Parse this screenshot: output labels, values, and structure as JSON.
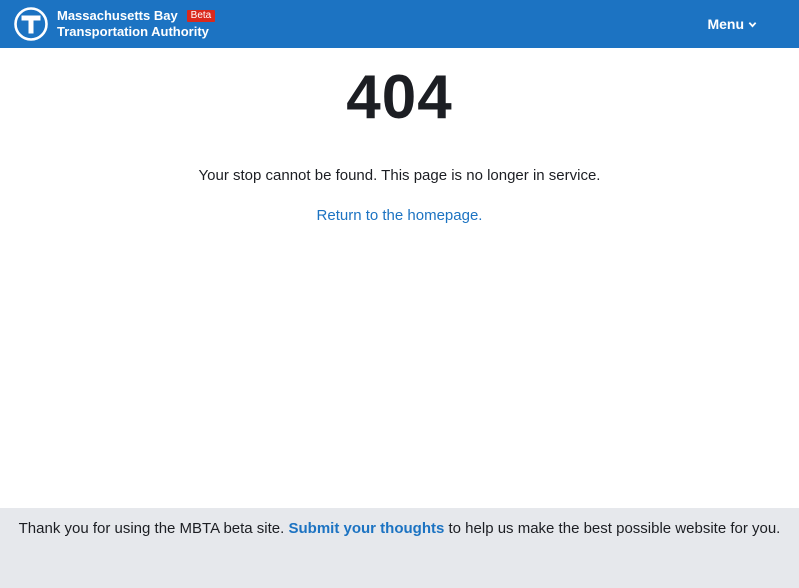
{
  "header": {
    "brand_line1": "Massachusetts Bay",
    "brand_line2": "Transportation Authority",
    "beta_badge": "Beta",
    "menu_label": "Menu",
    "logo_icon": "mbta-t-logo-icon",
    "menu_icon": "chevron-down-icon",
    "colors": {
      "header_bg": "#1c73c2",
      "beta_bg": "#da291c"
    }
  },
  "main": {
    "error_code": "404",
    "message": "Your stop cannot be found. This page is no longer in service.",
    "homepage_link": "Return to the homepage."
  },
  "footer": {
    "text_before": "Thank you for using the MBTA beta site.",
    "link_text": "Submit your thoughts",
    "text_after": "to help us make the best possible website for you.",
    "colors": {
      "footer_bg": "#e6e8ec",
      "link": "#1c73c2"
    }
  }
}
